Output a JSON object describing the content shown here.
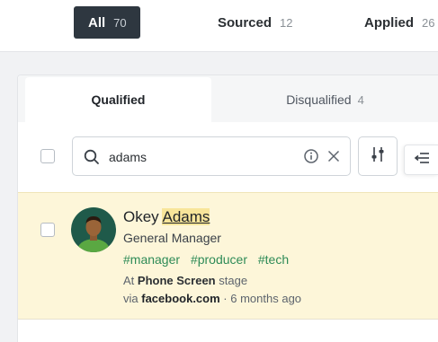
{
  "segments": [
    {
      "label": "All",
      "count": "70",
      "active": true
    },
    {
      "label": "Sourced",
      "count": "12",
      "active": false
    },
    {
      "label": "Applied",
      "count": "26",
      "active": false
    }
  ],
  "tabs": {
    "qualified": {
      "label": "Qualified"
    },
    "disqualified": {
      "label": "Disqualified",
      "count": "4"
    }
  },
  "search": {
    "value": "adams",
    "placeholder": ""
  },
  "icons": {
    "search": "search-icon",
    "info": "info-icon",
    "clear": "close-icon",
    "filter": "sliders-icon",
    "collapse": "collapse-left-icon"
  },
  "candidate": {
    "first_name": "Okey",
    "last_name": "Adams",
    "title": "General Manager",
    "tags": [
      "#manager",
      "#producer",
      "#tech"
    ],
    "stage_prefix": "At",
    "stage": "Phone Screen",
    "stage_suffix": "stage",
    "via_prefix": "via",
    "source": "facebook.com",
    "separator": "·",
    "time": "6 months ago"
  },
  "colors": {
    "active_segment": "#2e3740",
    "highlight_row": "#fdf6d9",
    "tag": "#2e8b57",
    "search_highlight": "#f8e59a"
  }
}
